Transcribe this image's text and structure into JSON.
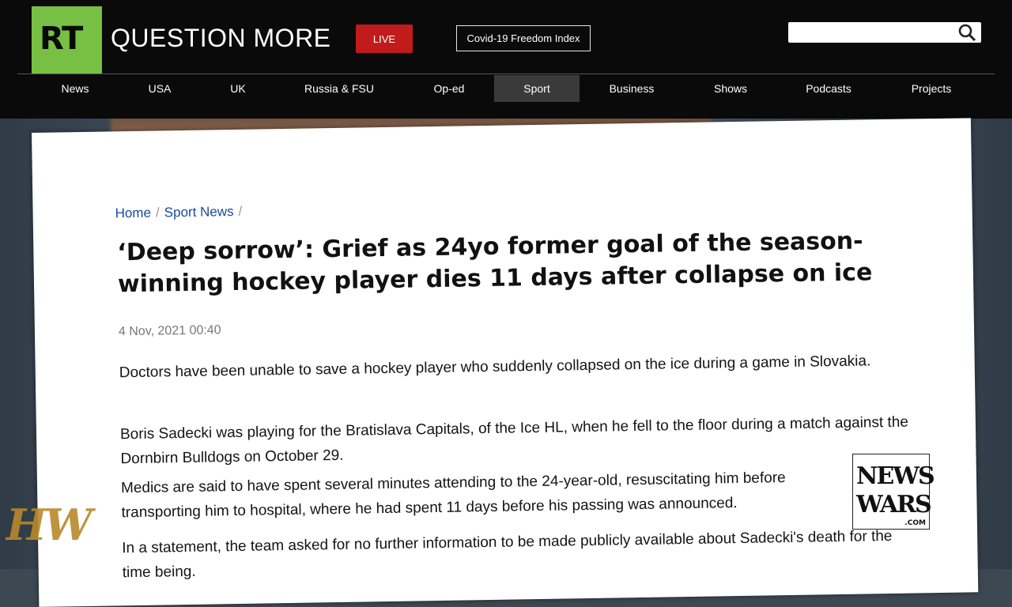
{
  "header": {
    "logo": "RT",
    "tagline": "QUESTION MORE",
    "live_label": "LIVE",
    "covid_label": "Covid-19 Freedom Index",
    "search_placeholder": ""
  },
  "nav": {
    "items": [
      {
        "label": "News"
      },
      {
        "label": "USA"
      },
      {
        "label": "UK"
      },
      {
        "label": "Russia & FSU"
      },
      {
        "label": "Op-ed"
      },
      {
        "label": "Sport"
      },
      {
        "label": "Business"
      },
      {
        "label": "Shows"
      },
      {
        "label": "Podcasts"
      },
      {
        "label": "Projects"
      }
    ],
    "active": "Sport"
  },
  "article": {
    "breadcrumb": {
      "home": "Home",
      "section": "Sport News",
      "sep": "/"
    },
    "title": "‘Deep sorrow’: Grief as 24yo former goal of the season-winning hockey player dies 11 days after collapse on ice",
    "date": "4 Nov, 2021 00:40",
    "paragraphs": [
      "Doctors have been unable to save a hockey player who suddenly collapsed on the ice during a game in Slovakia.",
      "Boris Sadecki was playing for the Bratislava Capitals, of the Ice HL, when he fell to the floor during a match against the Dornbirn Bulldogs on October 29.",
      "Medics are said to have spent several minutes attending to the 24-year-old, resuscitating him before transporting him to hospital, where he had spent 11 days before his passing was announced.",
      "In a statement, the team asked for no further information to be made publicly available about Sadecki's death for the time being."
    ]
  },
  "watermarks": {
    "hw": "HW",
    "newswars_line1": "NEWS",
    "newswars_line2": "WARS",
    "newswars_line3": ".COM"
  },
  "colors": {
    "brand_green": "#77c043",
    "live_red": "#c11b1b",
    "link_blue": "#1a4a9b"
  }
}
